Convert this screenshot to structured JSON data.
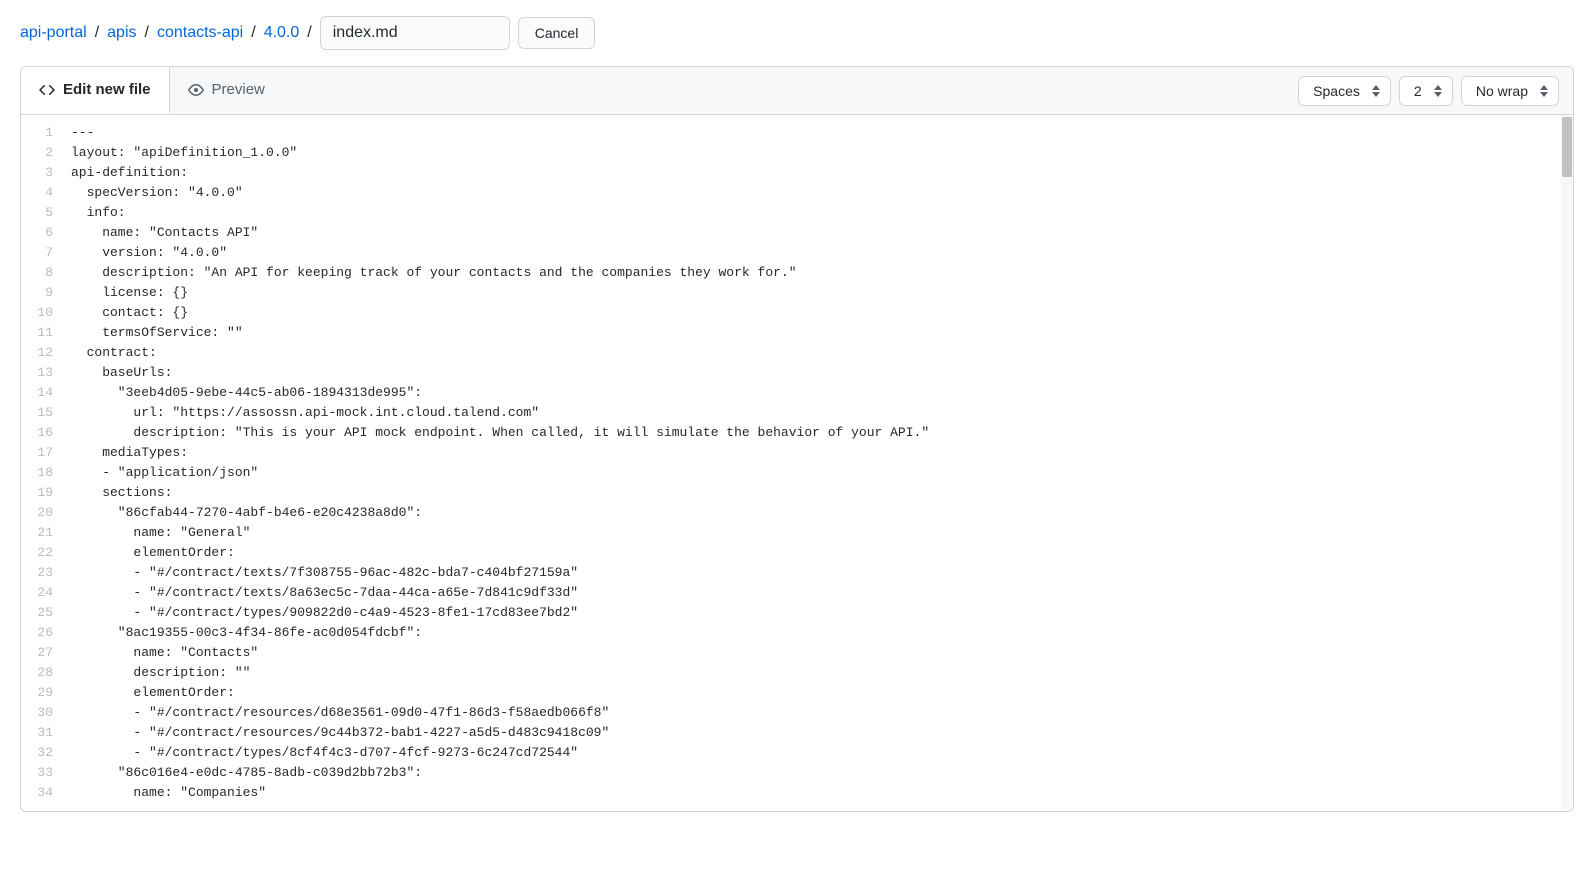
{
  "breadcrumb": {
    "items": [
      "api-portal",
      "apis",
      "contacts-api",
      "4.0.0"
    ],
    "filename": "index.md",
    "cancel": "Cancel"
  },
  "tabs": {
    "edit": "Edit new file",
    "preview": "Preview"
  },
  "controls": {
    "indent_mode": "Spaces",
    "indent_size": "2",
    "wrap_mode": "No wrap"
  },
  "code": {
    "lines": [
      "---",
      "layout: \"apiDefinition_1.0.0\"",
      "api-definition:",
      "  specVersion: \"4.0.0\"",
      "  info:",
      "    name: \"Contacts API\"",
      "    version: \"4.0.0\"",
      "    description: \"An API for keeping track of your contacts and the companies they work for.\"",
      "    license: {}",
      "    contact: {}",
      "    termsOfService: \"\"",
      "  contract:",
      "    baseUrls:",
      "      \"3eeb4d05-9ebe-44c5-ab06-1894313de995\":",
      "        url: \"https://assossn.api-mock.int.cloud.talend.com\"",
      "        description: \"This is your API mock endpoint. When called, it will simulate the behavior of your API.\"",
      "    mediaTypes:",
      "    - \"application/json\"",
      "    sections:",
      "      \"86cfab44-7270-4abf-b4e6-e20c4238a8d0\":",
      "        name: \"General\"",
      "        elementOrder:",
      "        - \"#/contract/texts/7f308755-96ac-482c-bda7-c404bf27159a\"",
      "        - \"#/contract/texts/8a63ec5c-7daa-44ca-a65e-7d841c9df33d\"",
      "        - \"#/contract/types/909822d0-c4a9-4523-8fe1-17cd83ee7bd2\"",
      "      \"8ac19355-00c3-4f34-86fe-ac0d054fdcbf\":",
      "        name: \"Contacts\"",
      "        description: \"\"",
      "        elementOrder:",
      "        - \"#/contract/resources/d68e3561-09d0-47f1-86d3-f58aedb066f8\"",
      "        - \"#/contract/resources/9c44b372-bab1-4227-a5d5-d483c9418c09\"",
      "        - \"#/contract/types/8cf4f4c3-d707-4fcf-9273-6c247cd72544\"",
      "      \"86c016e4-e0dc-4785-8adb-c039d2bb72b3\":",
      "        name: \"Companies\""
    ]
  }
}
